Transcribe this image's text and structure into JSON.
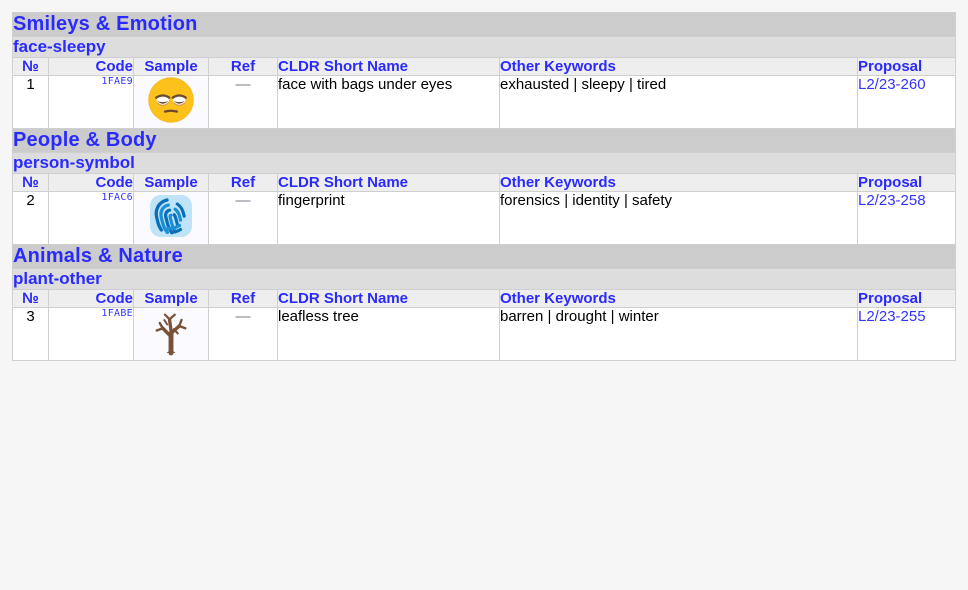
{
  "columns": {
    "num": "№",
    "code": "Code",
    "sample": "Sample",
    "ref": "Ref",
    "name": "CLDR Short Name",
    "keywords": "Other Keywords",
    "proposal": "Proposal"
  },
  "colors": {
    "category_header_bg": "#cccccc",
    "subcategory_header_bg": "#dddddd",
    "column_header_bg": "#eeeeee",
    "header_text": "#2a2aff",
    "link": "#3333ff",
    "page_bg": "#f6f6f6",
    "border": "#cfcfcf",
    "sample_cell_bg": "#fbfbff"
  },
  "sections": [
    {
      "category": "Smileys & Emotion",
      "subcategory": "face-sleepy",
      "rows": [
        {
          "num": "1",
          "code": "1FAE9",
          "sample_icon": "face-with-bags-under-eyes-emoji",
          "ref": "—",
          "name": "face with bags under eyes",
          "keywords": "exhausted | sleepy | tired",
          "proposal": "L2/23-260"
        }
      ]
    },
    {
      "category": "People & Body",
      "subcategory": "person-symbol",
      "rows": [
        {
          "num": "2",
          "code": "1FAC6",
          "sample_icon": "fingerprint-emoji",
          "ref": "—",
          "name": "fingerprint",
          "keywords": "forensics | identity | safety",
          "proposal": "L2/23-258"
        }
      ]
    },
    {
      "category": "Animals & Nature",
      "subcategory": "plant-other",
      "rows": [
        {
          "num": "3",
          "code": "1FABE",
          "sample_icon": "leafless-tree-emoji",
          "ref": "—",
          "name": "leafless tree",
          "keywords": "barren | drought | winter",
          "proposal": "L2/23-255"
        }
      ]
    }
  ]
}
